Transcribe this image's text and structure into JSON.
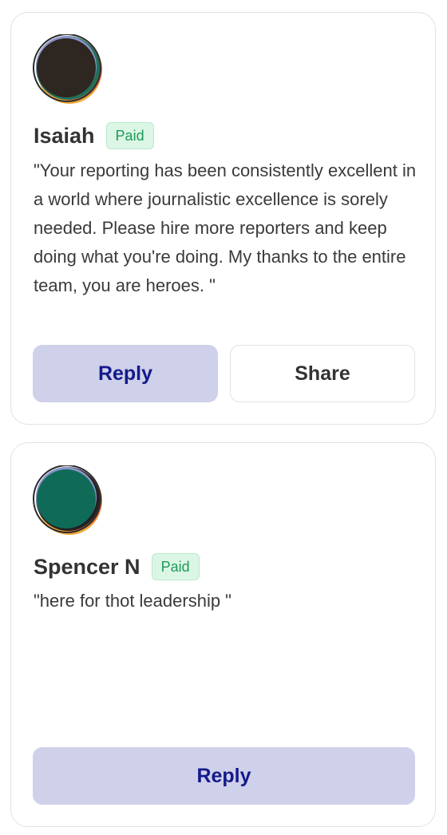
{
  "comments": [
    {
      "name": "Isaiah",
      "badge": "Paid",
      "text": "\"Your reporting has been consistently excellent in a world where journalistic excellence is sorely needed. Please hire more reporters and keep doing what you're doing. My thanks to the entire team, you are heroes. \"",
      "reply_label": "Reply",
      "share_label": "Share",
      "avatar_colors": {
        "main": "#2e2620",
        "ring": "#1f6f5a",
        "accent": "#f0a93a"
      }
    },
    {
      "name": "Spencer N",
      "badge": "Paid",
      "text": "\"here for thot leadership \"",
      "reply_label": "Reply",
      "avatar_colors": {
        "main": "#0f6b58",
        "ring": "#222222",
        "accent": "#f0a93a"
      }
    }
  ],
  "colors": {
    "reply_bg": "#cfd0ea",
    "reply_text": "#141a8a",
    "badge_bg": "#dcf6e6",
    "badge_text": "#1f9a58"
  }
}
